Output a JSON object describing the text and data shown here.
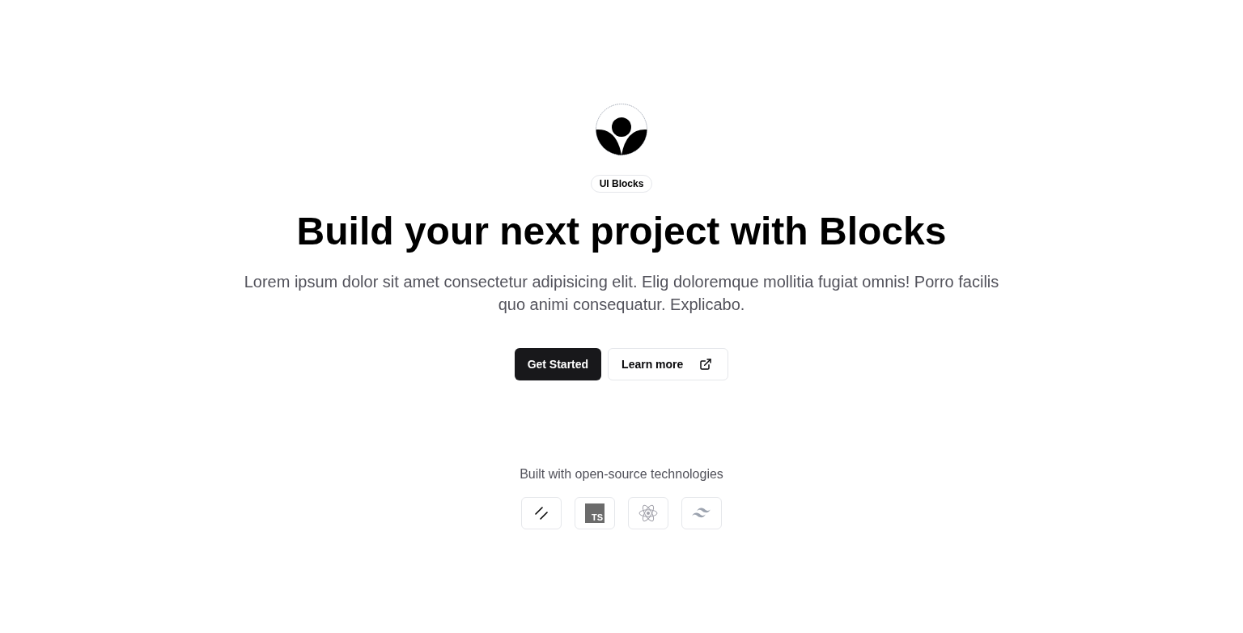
{
  "badge": "UI Blocks",
  "heading": "Build your next project with Blocks",
  "description": "Lorem ipsum dolor sit amet consectetur adipisicing elit. Elig doloremque mollitia fugiat omnis! Porro facilis quo animi consequatur. Explicabo.",
  "buttons": [
    {
      "label": "Get Started",
      "kind": "primary",
      "external": false
    },
    {
      "label": "Learn more",
      "kind": "outline",
      "external": true
    }
  ],
  "tech": {
    "caption": "Built with open-source technologies",
    "logos": [
      {
        "kind": "slashes"
      },
      {
        "kind": "ts-tile",
        "text": "TS"
      },
      {
        "kind": "atom"
      },
      {
        "kind": "waves"
      }
    ]
  }
}
